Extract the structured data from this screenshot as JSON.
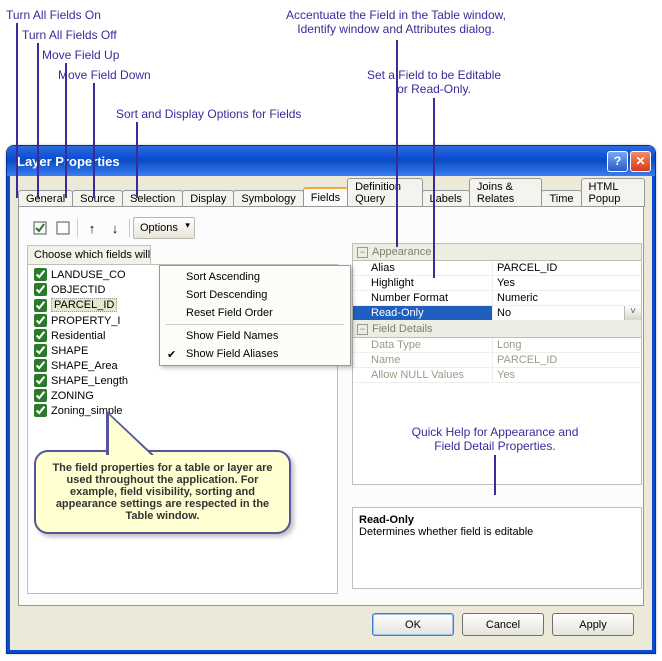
{
  "callouts": {
    "all_on": "Turn All Fields On",
    "all_off": "Turn All Fields Off",
    "move_up": "Move Field Up",
    "move_down": "Move Field Down",
    "sort_opts": "Sort and Display Options for Fields",
    "accent": "Accentuate the Field in the Table window,\nIdentify window and Attributes dialog.",
    "editable": "Set a Field to be Editable\nor Read-Only.",
    "quickhelp": "Quick Help for Appearance and\nField Detail Properties."
  },
  "window": {
    "title": "Layer Properties"
  },
  "tabs": [
    "General",
    "Source",
    "Selection",
    "Display",
    "Symbology",
    "Fields",
    "Definition Query",
    "Labels",
    "Joins & Relates",
    "Time",
    "HTML Popup"
  ],
  "active_tab": "Fields",
  "toolbar": {
    "options_label": "Options"
  },
  "choose_label": "Choose which fields will",
  "fields": [
    {
      "name": "LANDUSE_CO",
      "checked": true,
      "selected": false
    },
    {
      "name": "OBJECTID",
      "checked": true,
      "selected": false
    },
    {
      "name": "PARCEL_ID",
      "checked": true,
      "selected": true
    },
    {
      "name": "PROPERTY_I",
      "checked": true,
      "selected": false
    },
    {
      "name": "Residential",
      "checked": true,
      "selected": false
    },
    {
      "name": "SHAPE",
      "checked": true,
      "selected": false
    },
    {
      "name": "SHAPE_Area",
      "checked": true,
      "selected": false
    },
    {
      "name": "SHAPE_Length",
      "checked": true,
      "selected": false
    },
    {
      "name": "ZONING",
      "checked": true,
      "selected": false
    },
    {
      "name": "Zoning_simple",
      "checked": true,
      "selected": false
    }
  ],
  "options_menu": {
    "sort_asc": "Sort Ascending",
    "sort_desc": "Sort Descending",
    "reset": "Reset Field Order",
    "show_names": "Show Field Names",
    "show_aliases": "Show Field Aliases",
    "aliases_checked": true
  },
  "propgrid": {
    "appearance_cat": "Appearance",
    "alias_k": "Alias",
    "alias_v": "PARCEL_ID",
    "highlight_k": "Highlight",
    "highlight_v": "Yes",
    "numfmt_k": "Number Format",
    "numfmt_v": "Numeric",
    "readonly_k": "Read-Only",
    "readonly_v": "No",
    "details_cat": "Field Details",
    "dtype_k": "Data Type",
    "dtype_v": "Long",
    "name_k": "Name",
    "name_v": "PARCEL_ID",
    "null_k": "Allow NULL Values",
    "null_v": "Yes"
  },
  "helpbox": {
    "title": "Read-Only",
    "body": "Determines whether field is editable"
  },
  "speech": "The field properties for a table or layer are used throughout the application.  For example, field visibility, sorting and appearance settings are respected in the Table window.",
  "buttons": {
    "ok": "OK",
    "cancel": "Cancel",
    "apply": "Apply"
  }
}
